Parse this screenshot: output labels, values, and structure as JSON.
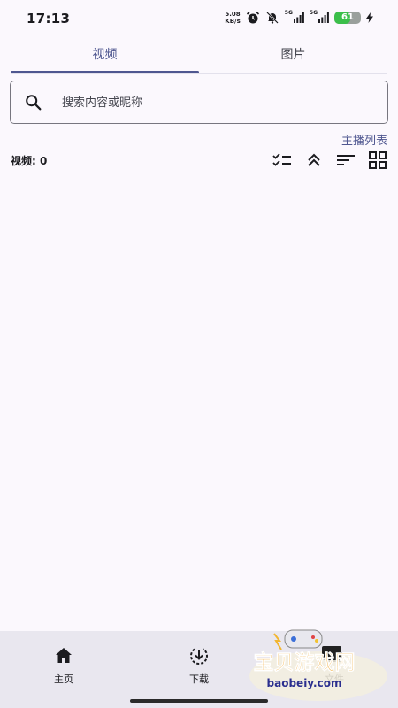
{
  "status_bar": {
    "time": "17:13",
    "net_speed_value": "5.08",
    "net_speed_unit": "KB/s",
    "signal_1_label": "5G",
    "signal_2_label": "5G",
    "battery_level": 61,
    "battery_text": "61",
    "icons": [
      "alarm-icon",
      "mute-icon",
      "signal-icon",
      "battery-icon",
      "charging-icon"
    ]
  },
  "tabs": [
    {
      "label": "视频",
      "active": true
    },
    {
      "label": "图片",
      "active": false
    }
  ],
  "search": {
    "placeholder": "搜索内容或昵称"
  },
  "streamer_list_label": "主播列表",
  "video_count_label": "视频: 0",
  "toolbar_icons": [
    "checklist-icon",
    "collapse-icon",
    "sort-icon",
    "grid-icon"
  ],
  "bottom_nav": {
    "items": [
      {
        "label": "主页",
        "icon": "home-icon"
      },
      {
        "label": "下载",
        "icon": "download-icon"
      },
      {
        "label": "文件",
        "icon": "folder-icon"
      }
    ]
  },
  "watermark": {
    "title": "宝贝游戏网",
    "url": "baobeiy.com"
  },
  "colors": {
    "accent": "#4f5790",
    "background": "#fbf8fd",
    "nav_background": "#e9e7ef",
    "battery_green": "#3bbf4a"
  }
}
